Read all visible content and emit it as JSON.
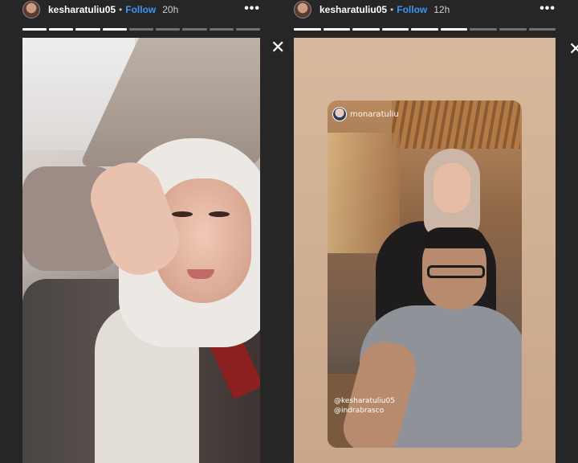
{
  "stories": [
    {
      "username": "kesharatuliu05",
      "separator": "•",
      "follow_label": "Follow",
      "time": "20h",
      "more_label": "•••",
      "segments_total": 9,
      "segments_done": 4
    },
    {
      "username": "kesharatuliu05",
      "separator": "•",
      "follow_label": "Follow",
      "time": "12h",
      "more_label": "•••",
      "segments_total": 9,
      "segments_done": 6,
      "close_label": "✕",
      "reshare": {
        "source_user": "monaratuliu",
        "mentions": [
          "@kesharatuliu05",
          "@indrabrasco"
        ]
      }
    }
  ],
  "close_label": "✕",
  "colors": {
    "background": "#262626",
    "follow": "#3897f0"
  }
}
